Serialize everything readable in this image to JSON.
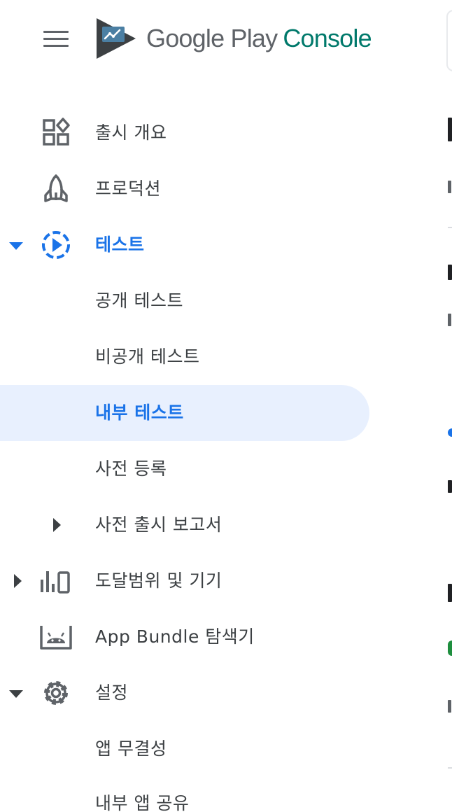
{
  "header": {
    "brand_google_play": "Google Play",
    "brand_console": "Console"
  },
  "nav": {
    "release_overview": "출시 개요",
    "production": "프로덕션",
    "testing": "테스트",
    "open_testing": "공개 테스트",
    "closed_testing": "비공개 테스트",
    "internal_testing": "내부 테스트",
    "pre_registration": "사전 등록",
    "pre_launch_report": "사전 출시 보고서",
    "reach_and_devices": "도달범위 및 기기",
    "app_bundle_explorer": "App Bundle 탐색기",
    "setup": "설정",
    "app_integrity": "앱 무결성",
    "internal_app_sharing": "내부 앱 공유"
  },
  "icons": {
    "menu": "hamburger-menu-icon",
    "logo": "google-play-console-logo",
    "release_overview": "dashboard-shapes-icon",
    "production": "rocket-icon",
    "testing": "play-circle-dashed-icon",
    "reach": "bar-chart-device-icon",
    "bundle": "android-box-icon",
    "setup": "gear-icon"
  },
  "colors": {
    "accent_blue": "#1a73e8",
    "active_bg": "#e8f0fe",
    "text_primary": "#3c4043",
    "icon_gray": "#5f6368",
    "brand_green": "#00796b"
  }
}
